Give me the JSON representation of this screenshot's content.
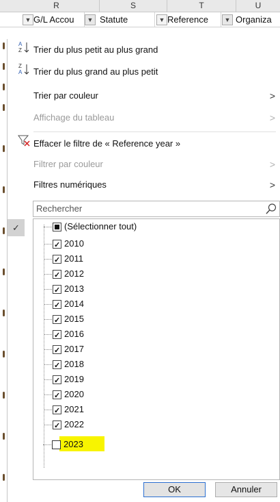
{
  "columns": [
    "R",
    "S",
    "T",
    "U"
  ],
  "filter_headers": [
    {
      "label": "G/L Accou",
      "filter_active": true
    },
    {
      "label": "Statute",
      "filter_active": false
    },
    {
      "label": "Reference",
      "filter_active": true
    },
    {
      "label": "Organiza",
      "filter_active": false
    }
  ],
  "menu": {
    "sort_asc": "Trier du plus petit au plus grand",
    "sort_desc": "Trier du plus grand au plus petit",
    "sort_by_color": "Trier par couleur",
    "table_view": "Affichage du tableau",
    "clear_filter": "Effacer le filtre de « Reference year »",
    "filter_by_color": "Filtrer par couleur",
    "number_filters": "Filtres numériques",
    "arrow": ">"
  },
  "search": {
    "placeholder": "Rechercher"
  },
  "list": {
    "select_all": "(Sélectionner tout)",
    "items": [
      {
        "label": "2010",
        "checked": true
      },
      {
        "label": "2011",
        "checked": true
      },
      {
        "label": "2012",
        "checked": true
      },
      {
        "label": "2013",
        "checked": true
      },
      {
        "label": "2014",
        "checked": true
      },
      {
        "label": "2015",
        "checked": true
      },
      {
        "label": "2016",
        "checked": true
      },
      {
        "label": "2017",
        "checked": true
      },
      {
        "label": "2018",
        "checked": true
      },
      {
        "label": "2019",
        "checked": true
      },
      {
        "label": "2020",
        "checked": true
      },
      {
        "label": "2021",
        "checked": true
      },
      {
        "label": "2022",
        "checked": true
      },
      {
        "label": "2023",
        "checked": false
      }
    ]
  },
  "buttons": {
    "ok": "OK",
    "cancel": "Annuler"
  },
  "colors": {
    "highlight": "#f8f400",
    "ok_border": "#2b6fd1"
  }
}
